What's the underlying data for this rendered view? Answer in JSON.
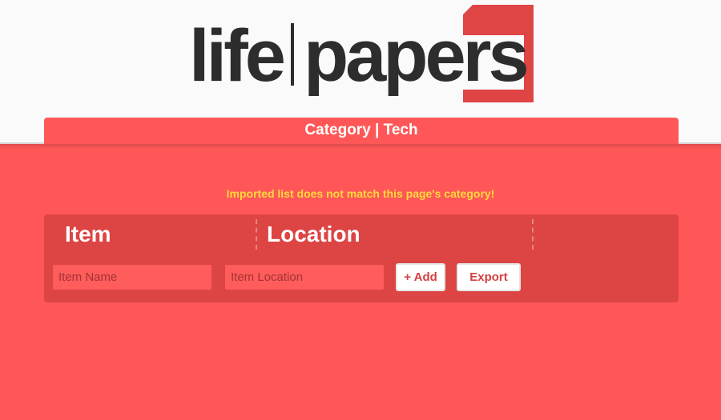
{
  "logo": {
    "text_left": "life",
    "text_right": "papers",
    "brand_color": "#e04545"
  },
  "category": {
    "label": "Category",
    "separator": "|",
    "value": "Tech"
  },
  "warning": "Imported list does not match this page's category!",
  "table": {
    "headers": [
      "Item",
      "Location"
    ]
  },
  "form": {
    "item_placeholder": "Item Name",
    "location_placeholder": "Item Location",
    "add_label": "+ Add",
    "export_label": "Export"
  },
  "colors": {
    "background": "#ff5757",
    "panel": "#dd4444",
    "warning": "#ffd93d"
  }
}
